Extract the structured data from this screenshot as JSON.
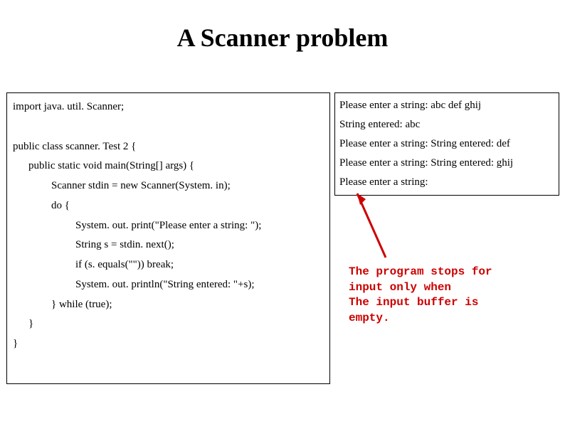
{
  "title": "A Scanner problem",
  "code": {
    "l1": "import java. util. Scanner;",
    "l2": "public class scanner. Test 2 {",
    "l3": "public static void main(String[] args) {",
    "l4": "Scanner stdin = new Scanner(System. in);",
    "l5": "do {",
    "l6": "System. out. print(\"Please enter a string: \");",
    "l7": "String s = stdin. next();",
    "l8": "if (s. equals(\"\")) break;",
    "l9": "System. out. println(\"String entered: \"+s);",
    "l10": "} while (true);",
    "l11": "}",
    "l12": "}"
  },
  "output": {
    "o1": "Please enter a string: abc def ghij",
    "o2": "String entered: abc",
    "o3": "Please enter a string: String entered: def",
    "o4": "Please enter a string: String entered: ghij",
    "o5": "Please enter a string:"
  },
  "annotation": {
    "a1": "The program stops for",
    "a2": "input only when",
    "a3": "The input buffer is",
    "a4": "empty."
  }
}
